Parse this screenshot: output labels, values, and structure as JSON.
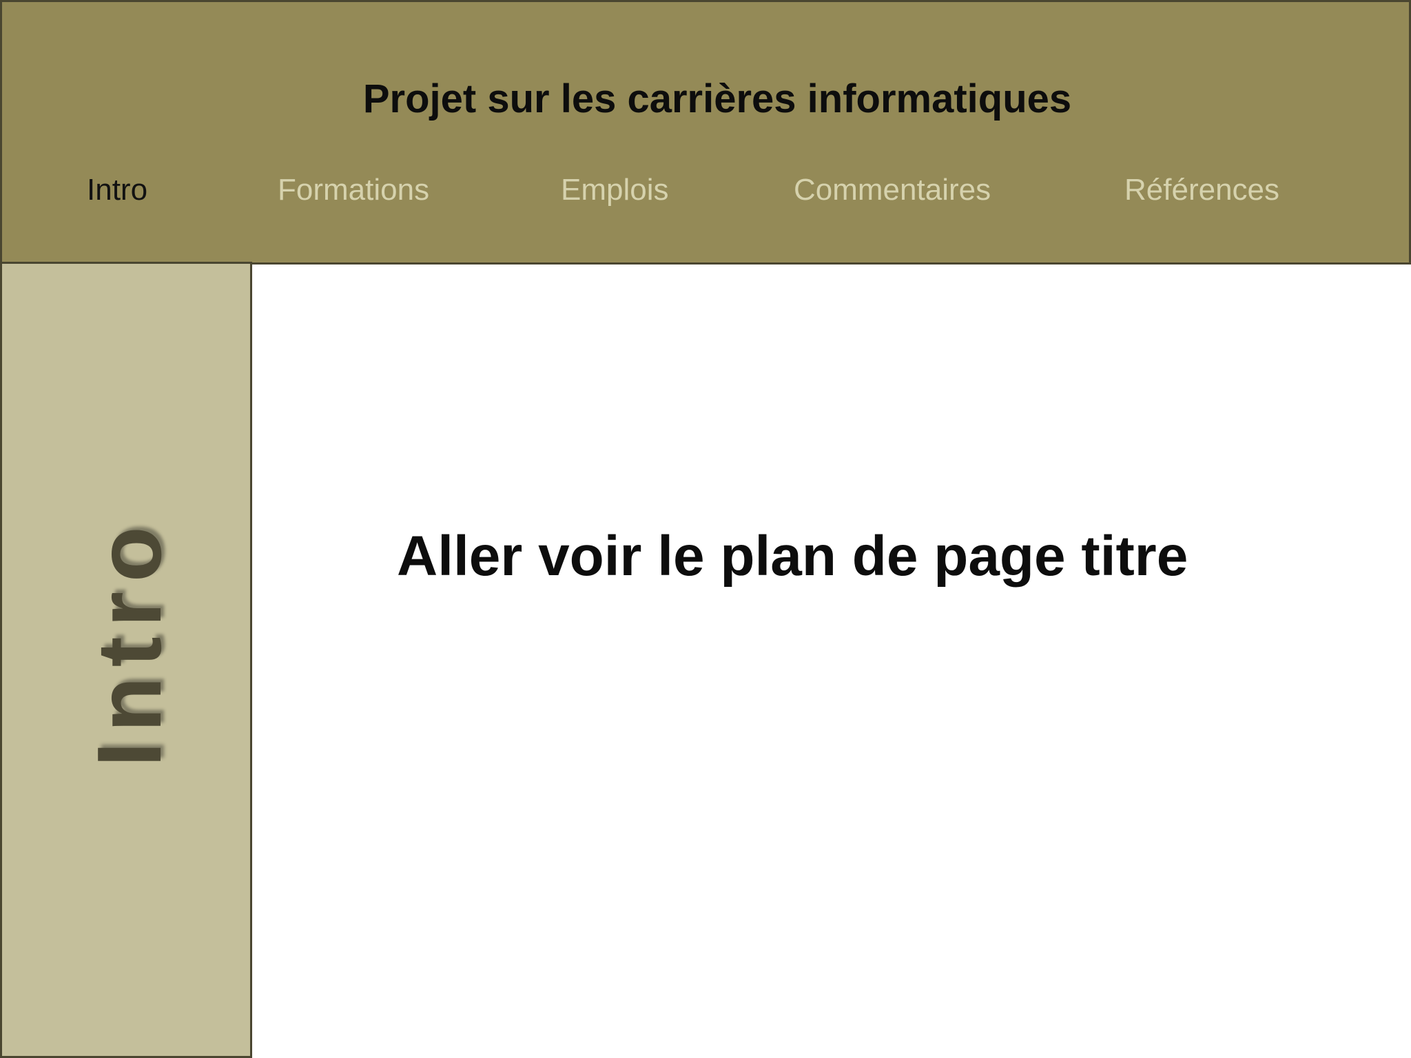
{
  "header": {
    "title": "Projet sur les carrières informatiques",
    "nav": [
      {
        "label": "Intro",
        "active": true
      },
      {
        "label": "Formations",
        "active": false
      },
      {
        "label": "Emplois",
        "active": false
      },
      {
        "label": "Commentaires",
        "active": false
      },
      {
        "label": "Références",
        "active": false
      }
    ]
  },
  "sidebar": {
    "label": "Intro"
  },
  "main": {
    "heading": "Aller voir le plan de page titre"
  },
  "colors": {
    "header_bg": "#948a57",
    "sidebar_bg": "#c4bf9b",
    "border": "#4a4630",
    "nav_inactive": "#d6d2ad",
    "nav_active": "#121212"
  }
}
